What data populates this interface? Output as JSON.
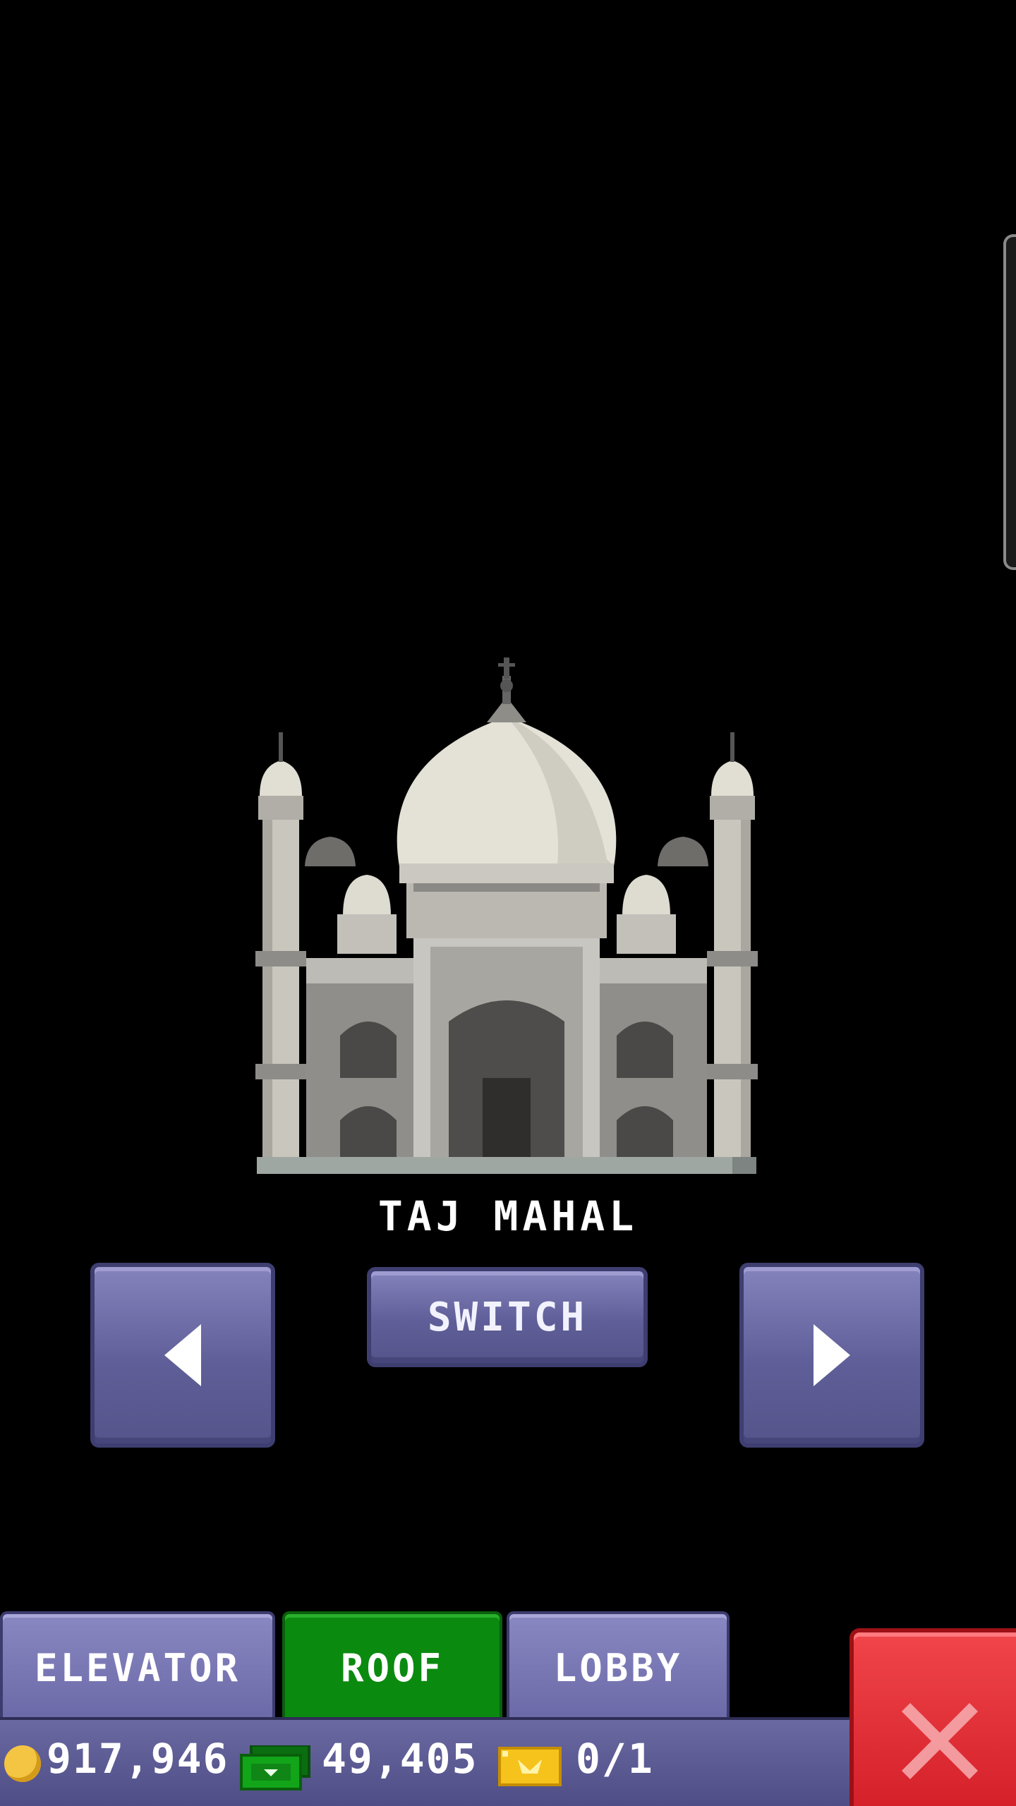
{
  "building": {
    "name": "TAJ MAHAL"
  },
  "controls": {
    "prev_icon": "triangle-left-icon",
    "next_icon": "triangle-right-icon",
    "switch_label": "SWITCH"
  },
  "tabs": [
    {
      "label": "ELEVATOR",
      "active": false
    },
    {
      "label": "ROOF",
      "active": true
    },
    {
      "label": "LOBBY",
      "active": false
    }
  ],
  "status": {
    "coins": "917,946",
    "bux": "49,405",
    "tickets": "0/1"
  },
  "close": {
    "icon": "close-x-icon"
  },
  "colors": {
    "button_purple": "#6462a0",
    "tab_active_green": "#0b8a10",
    "close_red": "#e2323a",
    "background": "#000000"
  }
}
